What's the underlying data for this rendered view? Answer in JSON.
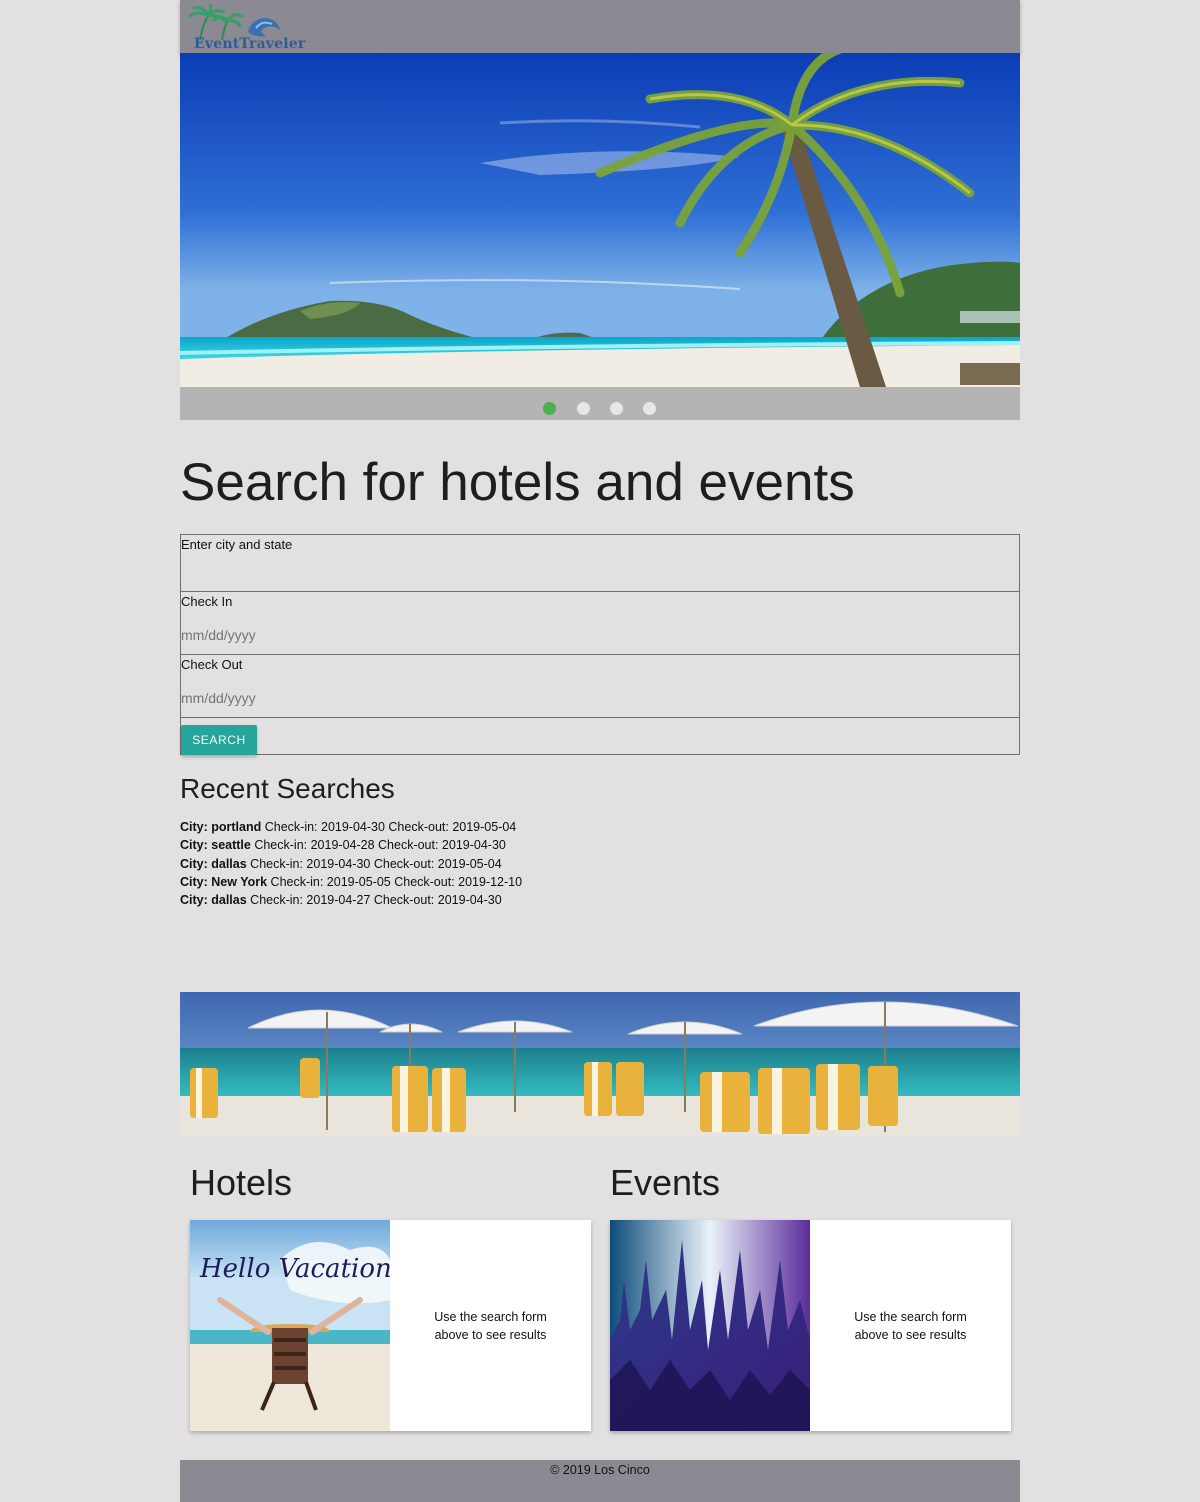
{
  "header": {
    "logo_text": "EventTraveler"
  },
  "carousel": {
    "slides": 4,
    "active_index": 0,
    "active_color": "#4caf50"
  },
  "search": {
    "title": "Search for hotels and events",
    "city_label": "Enter city and state",
    "checkin_label": "Check In",
    "checkin_placeholder": "mm/dd/yyyy",
    "checkout_label": "Check Out",
    "checkout_placeholder": "mm/dd/yyyy",
    "button_label": "SEARCH",
    "button_color": "#26a69a"
  },
  "recent": {
    "title": "Recent Searches",
    "items": [
      {
        "city_prefix": "City: ",
        "city": "portland",
        "rest": " Check-in: 2019-04-30 Check-out: 2019-05-04"
      },
      {
        "city_prefix": "City: ",
        "city": "seattle",
        "rest": " Check-in: 2019-04-28 Check-out: 2019-04-30"
      },
      {
        "city_prefix": "City: ",
        "city": "dallas",
        "rest": " Check-in: 2019-04-30 Check-out: 2019-05-04"
      },
      {
        "city_prefix": "City: ",
        "city": "New York",
        "rest": " Check-in: 2019-05-05 Check-out: 2019-12-10"
      },
      {
        "city_prefix": "City: ",
        "city": "dallas",
        "rest": " Check-in: 2019-04-27 Check-out: 2019-04-30"
      }
    ]
  },
  "hotels": {
    "title": "Hotels",
    "image_caption": "Hello Vacation",
    "text": "Use the search form above to see results"
  },
  "events": {
    "title": "Events",
    "text": "Use the search form above to see results"
  },
  "footer": {
    "text": "© 2019 Los Cinco"
  },
  "colors": {
    "navbar": "#8b8a92",
    "page_bg": "#e2e0e1"
  }
}
